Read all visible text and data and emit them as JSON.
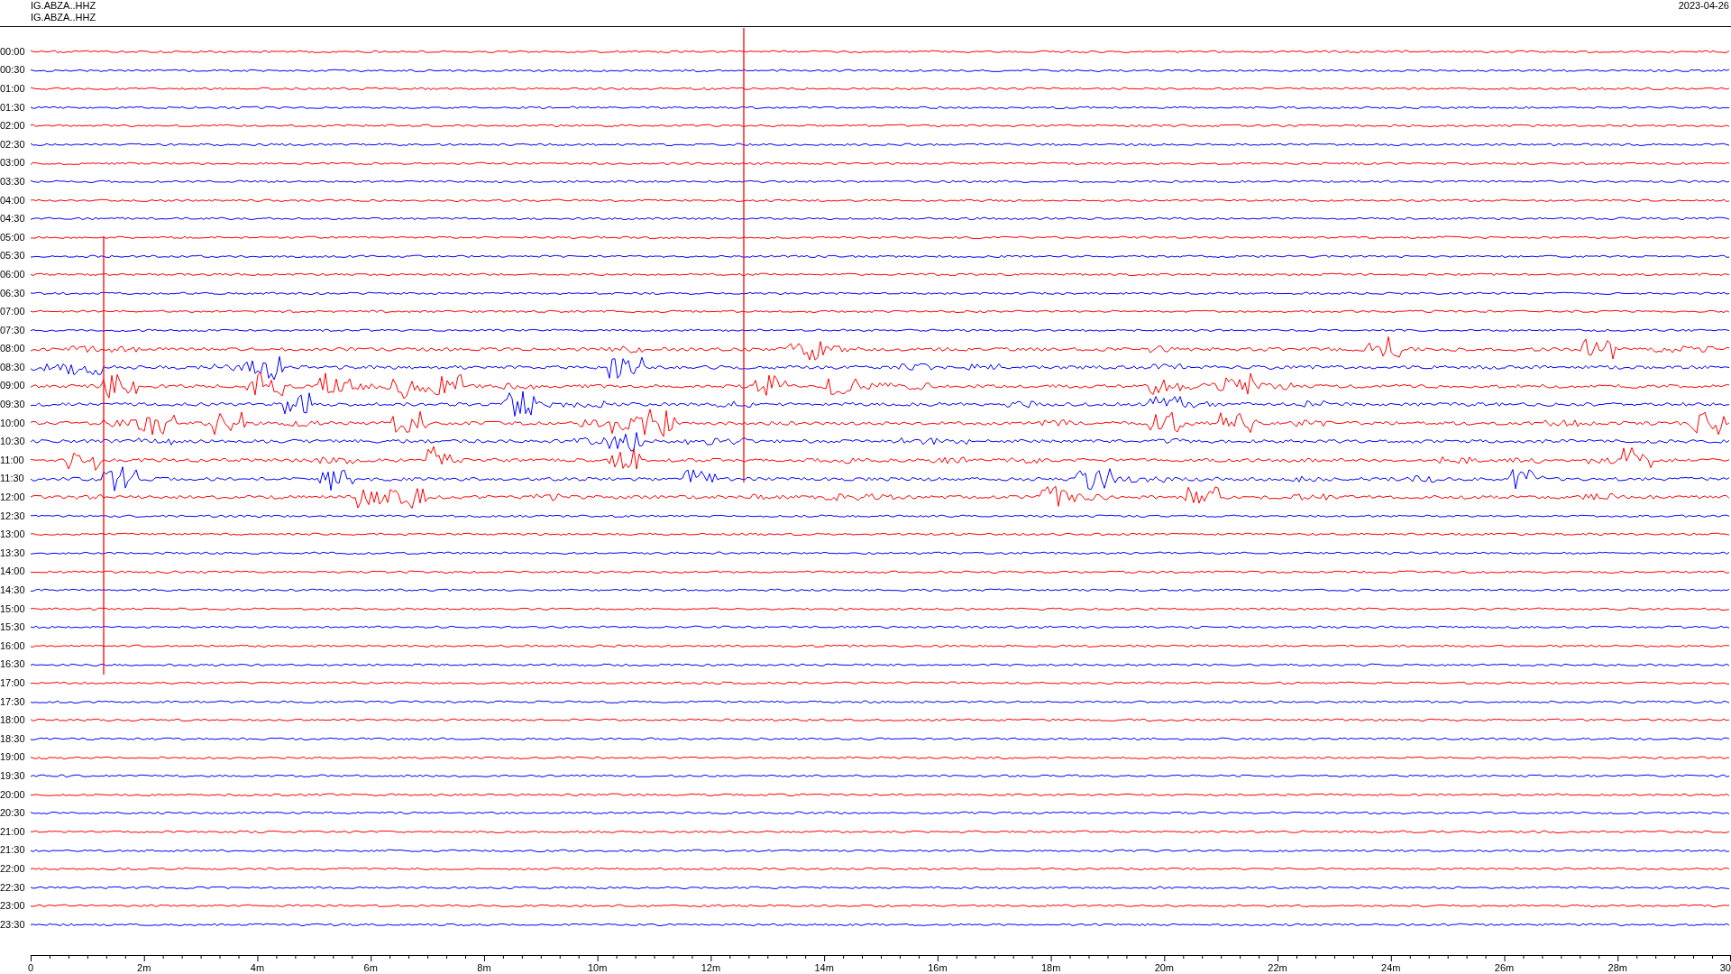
{
  "header": {
    "channels": [
      "IG.ABZA..HHZ",
      "IG.ABZA..HHZ"
    ],
    "date": "2023-04-26"
  },
  "traces": [
    {
      "time": "00:00",
      "color": "#ff0000",
      "kind": "quiet"
    },
    {
      "time": "00:30",
      "color": "#0000ff",
      "kind": "quiet"
    },
    {
      "time": "01:00",
      "color": "#ff0000",
      "kind": "quiet"
    },
    {
      "time": "01:30",
      "color": "#0000ff",
      "kind": "quiet"
    },
    {
      "time": "02:00",
      "color": "#ff0000",
      "kind": "quiet"
    },
    {
      "time": "02:30",
      "color": "#0000ff",
      "kind": "quiet"
    },
    {
      "time": "03:00",
      "color": "#ff0000",
      "kind": "quiet"
    },
    {
      "time": "03:30",
      "color": "#0000ff",
      "kind": "quiet"
    },
    {
      "time": "04:00",
      "color": "#ff0000",
      "kind": "quiet"
    },
    {
      "time": "04:30",
      "color": "#0000ff",
      "kind": "quiet"
    },
    {
      "time": "05:00",
      "color": "#ff0000",
      "kind": "quiet"
    },
    {
      "time": "05:30",
      "color": "#0000ff",
      "kind": "quiet"
    },
    {
      "time": "06:00",
      "color": "#ff0000",
      "kind": "quiet"
    },
    {
      "time": "06:30",
      "color": "#0000ff",
      "kind": "quiet"
    },
    {
      "time": "07:00",
      "color": "#ff0000",
      "kind": "quiet"
    },
    {
      "time": "07:30",
      "color": "#0000ff",
      "kind": "quiet"
    },
    {
      "time": "08:00",
      "color": "#ff0000",
      "kind": "busy"
    },
    {
      "time": "08:30",
      "color": "#0000ff",
      "kind": "busy"
    },
    {
      "time": "09:00",
      "color": "#ff0000",
      "kind": "busy"
    },
    {
      "time": "09:30",
      "color": "#0000ff",
      "kind": "busy"
    },
    {
      "time": "10:00",
      "color": "#ff0000",
      "kind": "busy"
    },
    {
      "time": "10:30",
      "color": "#0000ff",
      "kind": "busy"
    },
    {
      "time": "11:00",
      "color": "#ff0000",
      "kind": "busy"
    },
    {
      "time": "11:30",
      "color": "#0000ff",
      "kind": "busy"
    },
    {
      "time": "12:00",
      "color": "#ff0000",
      "kind": "busy"
    },
    {
      "time": "12:30",
      "color": "#0000ff",
      "kind": "quiet"
    },
    {
      "time": "13:00",
      "color": "#ff0000",
      "kind": "quiet"
    },
    {
      "time": "13:30",
      "color": "#0000ff",
      "kind": "quiet"
    },
    {
      "time": "14:00",
      "color": "#ff0000",
      "kind": "quiet"
    },
    {
      "time": "14:30",
      "color": "#0000ff",
      "kind": "quiet"
    },
    {
      "time": "15:00",
      "color": "#ff0000",
      "kind": "quiet"
    },
    {
      "time": "15:30",
      "color": "#0000ff",
      "kind": "quiet"
    },
    {
      "time": "16:00",
      "color": "#ff0000",
      "kind": "quiet"
    },
    {
      "time": "16:30",
      "color": "#0000ff",
      "kind": "quiet"
    },
    {
      "time": "17:00",
      "color": "#ff0000",
      "kind": "quiet"
    },
    {
      "time": "17:30",
      "color": "#0000ff",
      "kind": "quiet"
    },
    {
      "time": "18:00",
      "color": "#ff0000",
      "kind": "quiet"
    },
    {
      "time": "18:30",
      "color": "#0000ff",
      "kind": "quiet"
    },
    {
      "time": "19:00",
      "color": "#ff0000",
      "kind": "quiet"
    },
    {
      "time": "19:30",
      "color": "#0000ff",
      "kind": "quiet"
    },
    {
      "time": "20:00",
      "color": "#ff0000",
      "kind": "quiet"
    },
    {
      "time": "20:30",
      "color": "#0000ff",
      "kind": "quiet"
    },
    {
      "time": "21:00",
      "color": "#ff0000",
      "kind": "quiet"
    },
    {
      "time": "21:30",
      "color": "#0000ff",
      "kind": "quiet"
    },
    {
      "time": "22:00",
      "color": "#ff0000",
      "kind": "quiet"
    },
    {
      "time": "22:30",
      "color": "#0000ff",
      "kind": "quiet"
    },
    {
      "time": "23:00",
      "color": "#ff0000",
      "kind": "quiet"
    },
    {
      "time": "23:30",
      "color": "#0000ff",
      "kind": "quiet"
    }
  ],
  "axis": {
    "labels": [
      "0",
      "2m",
      "4m",
      "6m",
      "8m",
      "10m",
      "12m",
      "14m",
      "16m",
      "18m",
      "20m",
      "22m",
      "24m",
      "26m",
      "28m",
      "30"
    ]
  }
}
